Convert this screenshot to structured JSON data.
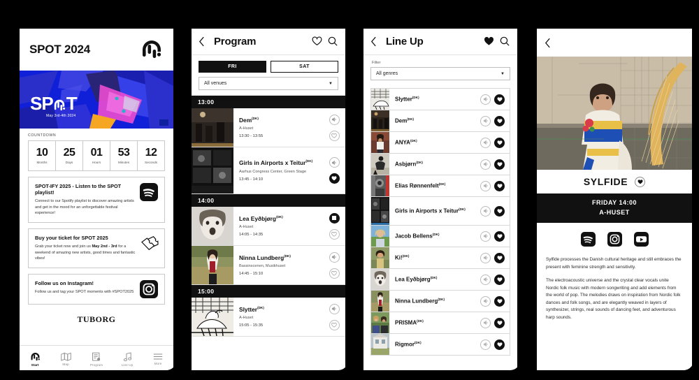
{
  "app": {
    "name": "SPOT Festival App"
  },
  "start_screen": {
    "header": {
      "title": "SPOT 2024",
      "logo_icon": "spot-drip-logo-icon"
    },
    "hero": {
      "wordmark": "SPOT",
      "date": "May 3rd-4th 2024"
    },
    "countdown": {
      "label": "COUNTDOWN",
      "cells": [
        {
          "value": "10",
          "unit": "Months"
        },
        {
          "value": "25",
          "unit": "Days"
        },
        {
          "value": "01",
          "unit": "Hours"
        },
        {
          "value": "53",
          "unit": "Minutes"
        },
        {
          "value": "12",
          "unit": "Seconds"
        }
      ]
    },
    "promos": [
      {
        "heading": "SPOT-IFY 2025 - Listen to the SPOT playlist!",
        "body": "Connect to our Spotify playlist to discover amazing artists and get in the mood for an unforgettable festival experience!",
        "icon": "spotify-icon"
      },
      {
        "heading": "Buy your ticket for SPOT 2025",
        "body_pre": "Grab your ticket now and join us ",
        "body_bold": "May 2nd - 3rd",
        "body_post": " for a weekend of amazing new artists, good times and fantastic vibes!",
        "icon": "ticket-icon"
      },
      {
        "heading": "Follow us on Instagram!",
        "body": "Follow us and tag your SPOT moments with #SPOT2025",
        "icon": "instagram-icon"
      }
    ],
    "sponsor": "TUBORG",
    "tabbar": [
      {
        "label": "Start",
        "icon": "spot-drip-logo-icon",
        "active": true
      },
      {
        "label": "Map",
        "icon": "map-icon",
        "active": false
      },
      {
        "label": "Program",
        "icon": "program-icon",
        "active": false
      },
      {
        "label": "Line Up",
        "icon": "music-note-icon",
        "active": false
      },
      {
        "label": "More",
        "icon": "hamburger-menu-icon",
        "active": false
      }
    ]
  },
  "program_screen": {
    "nav": {
      "back_icon": "chevron-left-icon",
      "title": "Program",
      "heart_icon": "heart-outline-icon",
      "search_icon": "search-icon"
    },
    "day_tabs": [
      {
        "label": "FRI",
        "selected": true
      },
      {
        "label": "SAT",
        "selected": false
      }
    ],
    "venue_filter": {
      "value": "All venues",
      "caret": "chevron-down-icon"
    },
    "groups": [
      {
        "time": "13:00",
        "items": [
          {
            "name": "Dem",
            "country": "(DK)",
            "venue": "A-Huset",
            "time": "13:30 - 13:55",
            "play_icon": "speaker-icon",
            "fav_icon": "heart-outline-icon",
            "fav_state": "off"
          },
          {
            "name": "Girls in Airports x Teitur",
            "country": "(DK)",
            "venue": "Aarhus Congress Center, Green Stage",
            "time": "13:45 - 14:10",
            "play_icon": "speaker-icon",
            "fav_icon": "heart-filled-icon",
            "fav_state": "on"
          }
        ]
      },
      {
        "time": "14:00",
        "items": [
          {
            "name": "Lea Eyðbjørg",
            "country": "(DK)",
            "venue": "A-Huset",
            "time": "14:05 - 14:35",
            "play_icon": "stop-icon",
            "fav_icon": "heart-outline-icon",
            "fav_state": "playing"
          },
          {
            "name": "Ninna Lundberg",
            "country": "(DK)",
            "venue": "Bassinscenen, Musikhuset",
            "time": "14:45 - 15:10",
            "play_icon": "speaker-icon",
            "fav_icon": "heart-outline-icon",
            "fav_state": "off"
          }
        ]
      },
      {
        "time": "15:00",
        "items": [
          {
            "name": "Slytter",
            "country": "(DK)",
            "venue": "A-Huset",
            "time": "15:05 - 15:35",
            "play_icon": "speaker-icon",
            "fav_icon": "heart-outline-icon",
            "fav_state": "off"
          }
        ]
      }
    ]
  },
  "lineup_screen": {
    "nav": {
      "back_icon": "chevron-left-icon",
      "title": "Line Up",
      "heart_icon": "heart-filled-icon",
      "search_icon": "search-icon"
    },
    "filter_label": "Filter",
    "genre_filter": {
      "value": "All genres",
      "caret": "chevron-down-icon"
    },
    "artists": [
      {
        "name": "Slytter",
        "country": "(DK)",
        "play_icon": "speaker-icon",
        "fav_icon": "heart-filled-icon"
      },
      {
        "name": "Dem",
        "country": "(DK)",
        "play_icon": "speaker-icon",
        "fav_icon": "heart-filled-icon"
      },
      {
        "name": "ANYA",
        "country": "(DK)",
        "play_icon": "speaker-icon",
        "fav_icon": "heart-filled-icon"
      },
      {
        "name": "Asbjørn",
        "country": "(DK)",
        "play_icon": "speaker-icon",
        "fav_icon": "heart-filled-icon"
      },
      {
        "name": "Elias Rønnenfelt",
        "country": "(DK)",
        "play_icon": "speaker-icon",
        "fav_icon": "heart-filled-icon"
      },
      {
        "name": "Girls in Airports x Teitur",
        "country": "(DK)",
        "play_icon": "speaker-icon",
        "fav_icon": "heart-filled-icon"
      },
      {
        "name": "Jacob Bellens",
        "country": "(DK)",
        "play_icon": "speaker-icon",
        "fav_icon": "heart-filled-icon"
      },
      {
        "name": "Ki!",
        "country": "(DK)",
        "play_icon": "speaker-icon",
        "fav_icon": "heart-filled-icon"
      },
      {
        "name": "Lea Eyðbjørg",
        "country": "(DK)",
        "play_icon": "speaker-icon",
        "fav_icon": "heart-filled-icon"
      },
      {
        "name": "Ninna Lundberg",
        "country": "(DK)",
        "play_icon": "speaker-icon",
        "fav_icon": "heart-filled-icon"
      },
      {
        "name": "PRISMA",
        "country": "(DK)",
        "play_icon": "speaker-icon",
        "fav_icon": "heart-filled-icon"
      },
      {
        "name": "Rigmor",
        "country": "(DK)",
        "play_icon": "speaker-icon",
        "fav_icon": "heart-filled-icon"
      }
    ]
  },
  "artist_screen": {
    "nav": {
      "back_icon": "chevron-left-icon"
    },
    "photo_alt": "artist-portrait-with-harp",
    "name": "SYLFIDE",
    "fav_icon": "heart-filled-icon",
    "when_day": "FRIDAY 14:00",
    "when_venue": "A-HUSET",
    "socials": [
      {
        "icon": "spotify-icon"
      },
      {
        "icon": "instagram-icon"
      },
      {
        "icon": "youtube-icon"
      }
    ],
    "bio": [
      "Sylfide processes the Danish cultural heritage and still embraces the present with feminine strength and sensitivity.",
      "The electroacoustic universe and the crystal clear vocals unite Nordic folk music with modern songwriting and add elements from the world of pop. The melodies draws on inspiration from Nordic folk dances and folk songs, and are elegantly weaved in layers of synthesizer, strings, real sounds of dancing feet, and adventurous harp sounds."
    ]
  },
  "colors": {
    "ink": "#111111",
    "hero_blue": "#1020d8",
    "hero_pink": "#e84bd0",
    "frame": "#000000"
  }
}
